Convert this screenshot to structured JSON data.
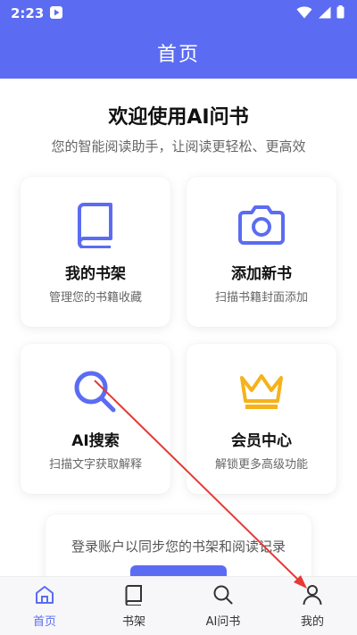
{
  "status": {
    "time": "2:23"
  },
  "header": {
    "title": "首页"
  },
  "welcome": {
    "title": "欢迎使用AI问书",
    "subtitle": "您的智能阅读助手，让阅读更轻松、更高效"
  },
  "cards": [
    {
      "title": "我的书架",
      "desc": "管理您的书籍收藏",
      "icon": "book-icon"
    },
    {
      "title": "添加新书",
      "desc": "扫描书籍封面添加",
      "icon": "camera-icon"
    },
    {
      "title": "AI搜索",
      "desc": "扫描文字获取解释",
      "icon": "search-icon"
    },
    {
      "title": "会员中心",
      "desc": "解锁更多高级功能",
      "icon": "crown-icon"
    }
  ],
  "login": {
    "text": "登录账户以同步您的书架和阅读记录"
  },
  "nav": [
    {
      "label": "首页",
      "icon": "home-icon",
      "active": true
    },
    {
      "label": "书架",
      "icon": "book-icon"
    },
    {
      "label": "AI问书",
      "icon": "search-icon"
    },
    {
      "label": "我的",
      "icon": "user-icon"
    }
  ],
  "colors": {
    "accent": "#5b6cf2",
    "gold": "#f5b21b",
    "annotation": "#e53935"
  }
}
